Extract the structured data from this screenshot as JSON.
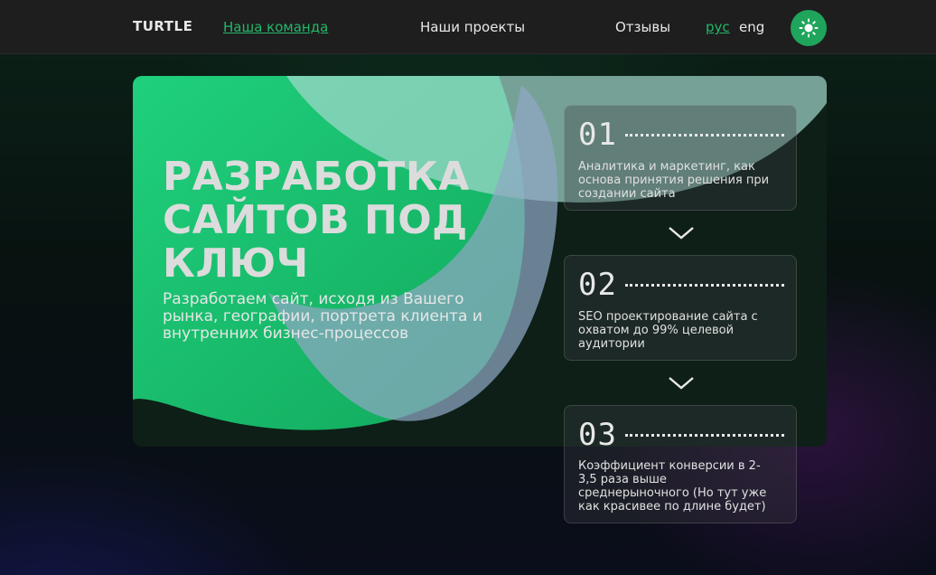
{
  "header": {
    "logo": "TURTLE",
    "nav": [
      {
        "label": "Наша команда",
        "active": true
      },
      {
        "label": "Наши проекты",
        "active": false
      },
      {
        "label": "Отзывы",
        "active": false
      }
    ],
    "lang": {
      "ru": "рус",
      "en": "eng",
      "active": "рус"
    },
    "theme_icon": "sun-icon"
  },
  "hero": {
    "title_lines": [
      "РАЗРАБОТКА",
      "САЙТОВ ПОД",
      "КЛЮЧ"
    ],
    "subtitle_lines": [
      "Разработаем сайт, исходя из Вашего",
      "рынка, географии, портрета клиента и",
      "внутренних бизнес-процессов"
    ]
  },
  "steps": [
    {
      "num": "01",
      "text_lines": [
        "Аналитика и маркетинг, как",
        "основа принятия решения при",
        "создании сайта"
      ]
    },
    {
      "num": "02",
      "text_lines": [
        "SEO проектирование сайта с",
        "охватом до 99% целевой",
        "аудитории"
      ]
    },
    {
      "num": "03",
      "text_lines": [
        "Коэффициент конверсии в 2-",
        "3,5 раза выше",
        "среднерыночного (Но тут уже",
        "как красивее по длине будет)"
      ]
    }
  ],
  "icons": {
    "step_arrow": "chevron-down-icon"
  },
  "colors": {
    "accent": "#22b868",
    "header_bg": "#1e1e1e",
    "hero_green": "#1ec97a",
    "overlay": "#8fb0c8"
  }
}
